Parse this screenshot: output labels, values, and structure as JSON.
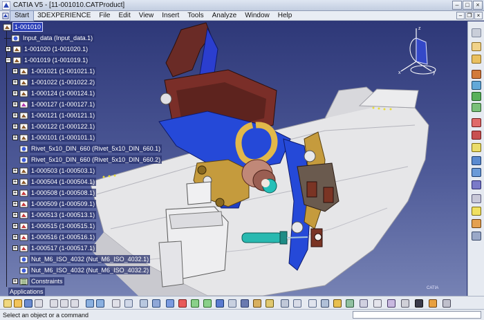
{
  "window": {
    "title": "CATIA V5 - [11-001010.CATProduct]"
  },
  "menu": [
    {
      "key": "start",
      "label": "Start",
      "active": true
    },
    {
      "key": "3dexperience",
      "label": "3DEXPERIENCE"
    },
    {
      "key": "file",
      "label": "File"
    },
    {
      "key": "edit",
      "label": "Edit"
    },
    {
      "key": "view",
      "label": "View"
    },
    {
      "key": "insert",
      "label": "Insert"
    },
    {
      "key": "tools",
      "label": "Tools"
    },
    {
      "key": "analyze",
      "label": "Analyze"
    },
    {
      "key": "window",
      "label": "Window"
    },
    {
      "key": "help",
      "label": "Help"
    }
  ],
  "tree": {
    "root": "1-001010",
    "nodes": [
      {
        "label": "Input_data (Input_data.1)",
        "icon": "part-icon"
      },
      {
        "label": "1-001020 (1-001020.1)",
        "icon": "product-icon"
      },
      {
        "label": "1-001019 (1-001019.1)",
        "icon": "product-icon"
      },
      {
        "label": "1-001021 (1-001021.1)",
        "icon": "product-icon"
      },
      {
        "label": "1-001022 (1-001022.2)",
        "icon": "product-icon"
      },
      {
        "label": "1-000124 (1-000124.1)",
        "icon": "product-icon"
      },
      {
        "label": "1-000127 (1-000127.1)",
        "icon": "product-icon"
      },
      {
        "label": "1-000121 (1-000121.1)",
        "icon": "product-icon"
      },
      {
        "label": "1-000122 (1-000122.1)",
        "icon": "product-icon"
      },
      {
        "label": "1-000101 (1-000101.1)",
        "icon": "product-icon"
      },
      {
        "label": "Rivet_5x10_DIN_660 (Rivet_5x10_DIN_660.1)",
        "icon": "part-icon"
      },
      {
        "label": "Rivet_5x10_DIN_660 (Rivet_5x10_DIN_660.2)",
        "icon": "part-icon"
      },
      {
        "label": "1-000503 (1-000503.1)",
        "icon": "product-icon"
      },
      {
        "label": "1-000504 (1-000504.1)",
        "icon": "product-icon"
      },
      {
        "label": "1-000508 (1-000508.1)",
        "icon": "product-icon"
      },
      {
        "label": "1-000509 (1-000509.1)",
        "icon": "product-icon"
      },
      {
        "label": "1-000513 (1-000513.1)",
        "icon": "product-icon"
      },
      {
        "label": "1-000515 (1-000515.1)",
        "icon": "product-icon"
      },
      {
        "label": "1-000516 (1-000516.1)",
        "icon": "product-icon"
      },
      {
        "label": "1-000517 (1-000517.1)",
        "icon": "product-icon"
      },
      {
        "label": "Nut_M6_ISO_4032 (Nut_M6_ISO_4032.1)",
        "icon": "part-icon"
      },
      {
        "label": "Nut_M6_ISO_4032 (Nut_M6_ISO_4032.2)",
        "icon": "part-icon"
      },
      {
        "label": "Constraints",
        "icon": "constraints-icon"
      },
      {
        "label": "Applications",
        "icon": "none"
      }
    ]
  },
  "status": {
    "message": "Select an object or a command"
  },
  "watermark": "CATIA",
  "colors": {
    "viewport_top": "#2e3878",
    "viewport_bottom": "#7682b4",
    "selection": "#2b3fb8",
    "part_blue": "#1f4fd6",
    "part_bronze": "#c49a3a",
    "part_gray": "#e4e4e4"
  }
}
